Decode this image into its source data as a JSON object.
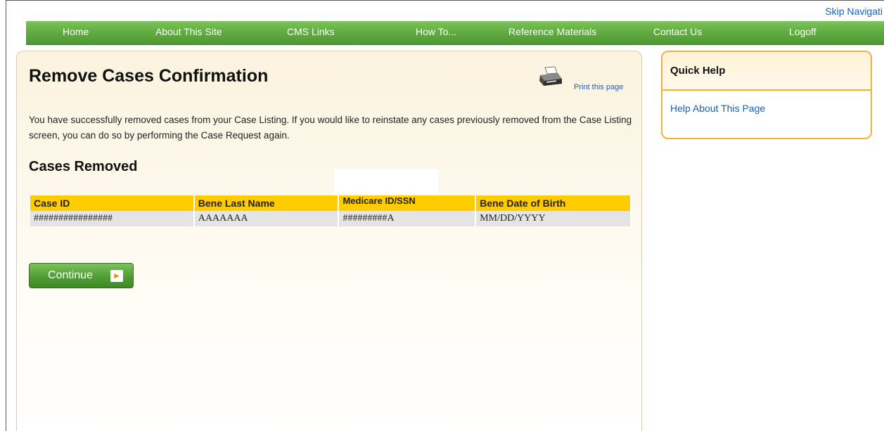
{
  "header": {
    "skip_nav": "Skip Navigati",
    "nav": [
      {
        "label": "Home"
      },
      {
        "label": "About This Site"
      },
      {
        "label": "CMS Links"
      },
      {
        "label": "How To..."
      },
      {
        "label": "Reference Materials"
      },
      {
        "label": "Contact Us"
      },
      {
        "label": "Logoff"
      }
    ]
  },
  "main": {
    "title": "Remove Cases Confirmation",
    "print_link": "Print this page",
    "print_icon": "printer-icon",
    "message": "You have successfully removed cases from your Case Listing. If you would like to reinstate any cases previously removed from the Case Listing screen, you can do so by performing the Case Request again.",
    "section_title": "Cases Removed",
    "table": {
      "columns": [
        "Case ID",
        "Bene Last Name",
        "Medicare ID/SSN",
        "Bene Date of Birth"
      ],
      "rows": [
        [
          "################",
          "AAAAAAA",
          "#########A",
          "MM/DD/YYYY"
        ]
      ]
    },
    "continue_label": "Continue",
    "continue_icon": "arrow-right-icon"
  },
  "quick_help": {
    "title": "Quick Help",
    "link": "Help About This Page"
  },
  "colors": {
    "nav_green": "#5ea93f",
    "table_header": "#ffcc00",
    "link_blue": "#1a5fb4",
    "quick_help_border": "#f2b13c"
  }
}
